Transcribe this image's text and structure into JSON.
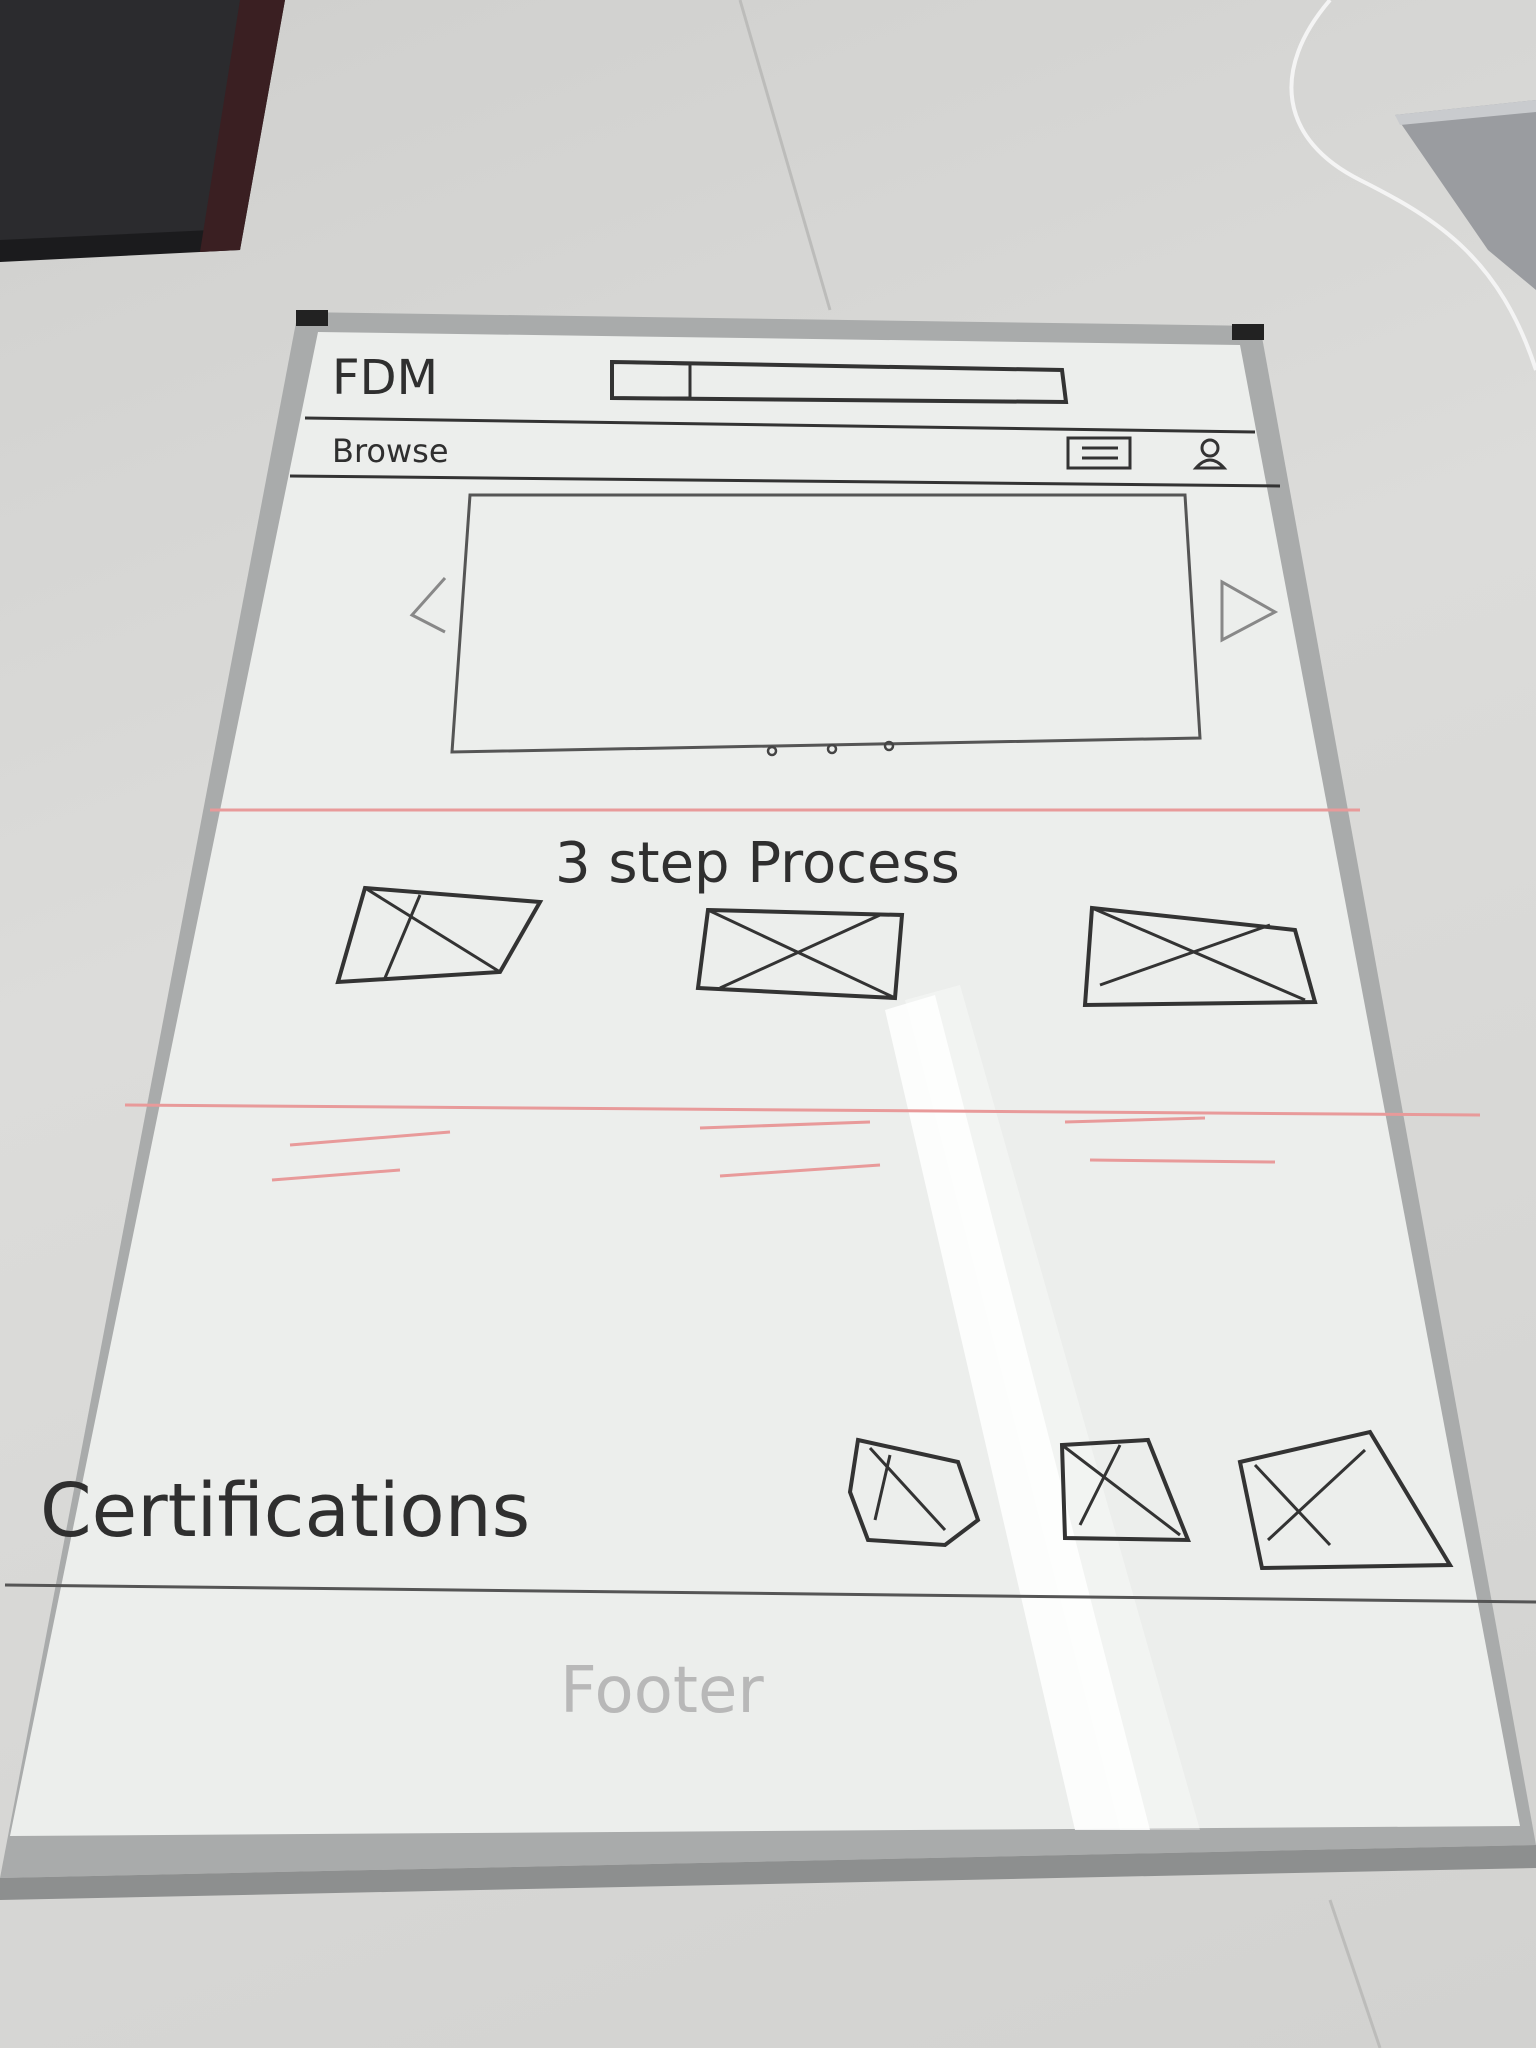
{
  "whiteboard": {
    "logo_text": "FDM",
    "nav_label": "Browse",
    "section_title": "3 step Process",
    "certifications_label": "Certifications",
    "footer_label": "Footer"
  },
  "colors": {
    "marker_black": "#2f2f2f",
    "marker_red": "#e58a8a",
    "board_white": "#eef0ee",
    "frame_aluminium": "#b4b6b6",
    "table": "#d6d6d4"
  },
  "icons": [
    "list-icon",
    "user-icon",
    "left-arrow-icon",
    "right-arrow-icon",
    "carousel-dots-icon"
  ]
}
